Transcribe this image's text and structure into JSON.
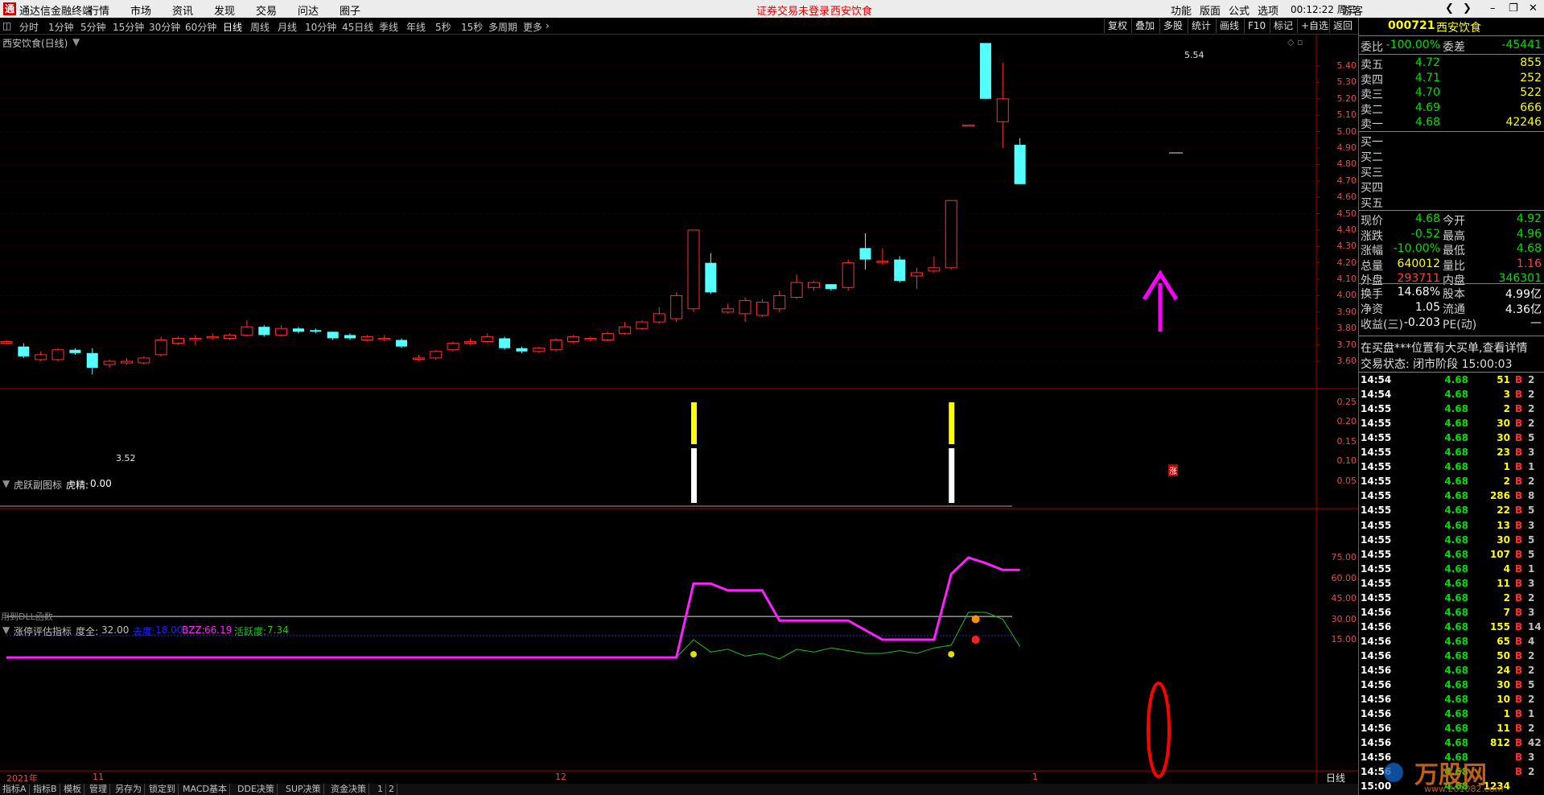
{
  "titlebar": {
    "app_title": "通达信金融终端",
    "menus": [
      "行情",
      "市场",
      "资讯",
      "发现",
      "交易",
      "问达",
      "圈子"
    ],
    "warning": "证券交易未登录",
    "stock_name": "西安饮食",
    "right_menus": [
      "功能",
      "版面",
      "公式",
      "选项"
    ],
    "clock": "00:12:22 周三",
    "user": "游客"
  },
  "periods": [
    "分时",
    "1分钟",
    "5分钟",
    "15分钟",
    "30分钟",
    "60分钟",
    "日线",
    "周线",
    "月线",
    "10分钟",
    "45日线",
    "季线",
    "年线",
    "5秒",
    "15秒",
    "多周期",
    "更多"
  ],
  "active_period": "日线",
  "toolbar": [
    "复权",
    "叠加",
    "多股",
    "统计",
    "画线",
    "F10",
    "标记",
    "+自选",
    "返回"
  ],
  "main_chart": {
    "title": "西安饮食(日线)",
    "high_label": "5.54",
    "low_label": "3.52",
    "badge": "涨",
    "y_ticks": [
      "5.40",
      "5.30",
      "5.20",
      "5.10",
      "5.00",
      "4.90",
      "4.80",
      "4.70",
      "4.60",
      "4.50",
      "4.40",
      "4.30",
      "4.20",
      "4.10",
      "4.00",
      "3.90",
      "3.80",
      "3.70",
      "3.60"
    ]
  },
  "indicator1": {
    "title": "虎跃副图标",
    "param_label": "虎精:",
    "param_value": "0.00",
    "footer": "用到DLL函数",
    "y_ticks": [
      "0.25",
      "0.20",
      "0.15",
      "0.10",
      "0.05"
    ]
  },
  "indicator2": {
    "title": "涨停评估指标",
    "items": [
      {
        "label": "度全:",
        "value": "32.00",
        "color": "#c0c0c0"
      },
      {
        "label": "去度:",
        "value": "18.00",
        "color": "#2020ff"
      },
      {
        "label": "BZZ:",
        "value": "66.19",
        "color": "#ff20ff"
      },
      {
        "label": "活跃度:",
        "value": "7.34",
        "color": "#20c020"
      }
    ],
    "y_ticks": [
      "75.00",
      "60.00",
      "45.00",
      "30.00",
      "15.00"
    ]
  },
  "x_axis": {
    "labels": [
      "2021年",
      "11",
      "12",
      "1"
    ],
    "right_label": "日线"
  },
  "bottom_tabs": [
    "指标A",
    "指标B",
    "模板",
    "管理",
    "另存为",
    "锁定到",
    "MACD基本",
    "DDE决策",
    "SUP决策",
    "资金决策",
    "1",
    "2"
  ],
  "info": {
    "code": "000721",
    "name": "西安饮食",
    "weibi_label": "委比",
    "weibi": "-100.00%",
    "weicha_label": "委差",
    "weicha": "-45441",
    "asks": [
      {
        "label": "卖五",
        "price": "4.72",
        "vol": "855"
      },
      {
        "label": "卖四",
        "price": "4.71",
        "vol": "252"
      },
      {
        "label": "卖三",
        "price": "4.70",
        "vol": "522"
      },
      {
        "label": "卖二",
        "price": "4.69",
        "vol": "666"
      },
      {
        "label": "卖一",
        "price": "4.68",
        "vol": "42246"
      }
    ],
    "bids": [
      "买一",
      "买二",
      "买三",
      "买四",
      "买五"
    ],
    "stats": [
      {
        "l1": "现价",
        "v1": "4.68",
        "c1": "green",
        "l2": "今开",
        "v2": "4.92",
        "c2": "green"
      },
      {
        "l1": "涨跌",
        "v1": "-0.52",
        "c1": "green",
        "l2": "最高",
        "v2": "4.96",
        "c2": "green"
      },
      {
        "l1": "涨幅",
        "v1": "-10.00%",
        "c1": "green",
        "l2": "最低",
        "v2": "4.68",
        "c2": "green"
      },
      {
        "l1": "总量",
        "v1": "640012",
        "c1": "yellow",
        "l2": "量比",
        "v2": "1.16",
        "c2": "red"
      },
      {
        "l1": "外盘",
        "v1": "293711",
        "c1": "red",
        "l2": "内盘",
        "v2": "346301",
        "c2": "green"
      }
    ],
    "fund": [
      {
        "l1": "换手",
        "v1": "14.68%",
        "l2": "股本",
        "v2": "4.99亿"
      },
      {
        "l1": "净资",
        "v1": "1.05",
        "l2": "流通",
        "v2": "4.36亿"
      },
      {
        "l1": "收益(三)",
        "v1": "-0.203",
        "l2": "PE(动)",
        "v2": "—"
      }
    ],
    "notice": "在买盘***位置有大买单,查看详情",
    "status": "交易状态: 闭市阶段 15:00:03",
    "ticks": [
      {
        "t": "14:54",
        "p": "4.68",
        "v": "51",
        "b": "B",
        "e": "2"
      },
      {
        "t": "14:54",
        "p": "4.68",
        "v": "3",
        "b": "B",
        "e": "2"
      },
      {
        "t": "14:55",
        "p": "4.68",
        "v": "2",
        "b": "B",
        "e": "2"
      },
      {
        "t": "14:55",
        "p": "4.68",
        "v": "30",
        "b": "B",
        "e": "2"
      },
      {
        "t": "14:55",
        "p": "4.68",
        "v": "30",
        "b": "B",
        "e": "5"
      },
      {
        "t": "14:55",
        "p": "4.68",
        "v": "23",
        "b": "B",
        "e": "3"
      },
      {
        "t": "14:55",
        "p": "4.68",
        "v": "1",
        "b": "B",
        "e": "1"
      },
      {
        "t": "14:55",
        "p": "4.68",
        "v": "2",
        "b": "B",
        "e": "2"
      },
      {
        "t": "14:55",
        "p": "4.68",
        "v": "286",
        "b": "B",
        "e": "8"
      },
      {
        "t": "14:55",
        "p": "4.68",
        "v": "22",
        "b": "B",
        "e": "5"
      },
      {
        "t": "14:55",
        "p": "4.68",
        "v": "13",
        "b": "B",
        "e": "3"
      },
      {
        "t": "14:55",
        "p": "4.68",
        "v": "30",
        "b": "B",
        "e": "5"
      },
      {
        "t": "14:55",
        "p": "4.68",
        "v": "107",
        "b": "B",
        "e": "5"
      },
      {
        "t": "14:55",
        "p": "4.68",
        "v": "4",
        "b": "B",
        "e": "1"
      },
      {
        "t": "14:55",
        "p": "4.68",
        "v": "11",
        "b": "B",
        "e": "3"
      },
      {
        "t": "14:55",
        "p": "4.68",
        "v": "2",
        "b": "B",
        "e": "2"
      },
      {
        "t": "14:56",
        "p": "4.68",
        "v": "7",
        "b": "B",
        "e": "3"
      },
      {
        "t": "14:56",
        "p": "4.68",
        "v": "155",
        "b": "B",
        "e": "14"
      },
      {
        "t": "14:56",
        "p": "4.68",
        "v": "65",
        "b": "B",
        "e": "4"
      },
      {
        "t": "14:56",
        "p": "4.68",
        "v": "50",
        "b": "B",
        "e": "2"
      },
      {
        "t": "14:56",
        "p": "4.68",
        "v": "24",
        "b": "B",
        "e": "2"
      },
      {
        "t": "14:56",
        "p": "4.68",
        "v": "30",
        "b": "B",
        "e": "5"
      },
      {
        "t": "14:56",
        "p": "4.68",
        "v": "10",
        "b": "B",
        "e": "2"
      },
      {
        "t": "14:56",
        "p": "4.68",
        "v": "1",
        "b": "B",
        "e": "1"
      },
      {
        "t": "14:56",
        "p": "4.68",
        "v": "11",
        "b": "B",
        "e": "2"
      },
      {
        "t": "14:56",
        "p": "4.68",
        "v": "812",
        "b": "B",
        "e": "42"
      },
      {
        "t": "14:56",
        "p": "4.68",
        "v": "",
        "b": "B",
        "e": "3"
      },
      {
        "t": "14:56",
        "p": "4.68",
        "v": "",
        "b": "B",
        "e": "2"
      },
      {
        "t": "15:00",
        "p": "4.68",
        "v": "1234",
        "b": "",
        "e": ""
      }
    ]
  },
  "watermark": {
    "text": "万股网",
    "url": "www.201082.com"
  },
  "chart_data": {
    "type": "candlestick",
    "title": "西安饮食(日线)",
    "ylim": [
      3.52,
      5.54
    ],
    "candles": [
      {
        "o": 3.71,
        "c": 3.72,
        "h": 3.73,
        "l": 3.7
      },
      {
        "o": 3.69,
        "c": 3.63,
        "h": 3.71,
        "l": 3.62
      },
      {
        "o": 3.61,
        "c": 3.64,
        "h": 3.66,
        "l": 3.6
      },
      {
        "o": 3.61,
        "c": 3.67,
        "h": 3.68,
        "l": 3.6
      },
      {
        "o": 3.67,
        "c": 3.65,
        "h": 3.68,
        "l": 3.64
      },
      {
        "o": 3.65,
        "c": 3.56,
        "h": 3.68,
        "l": 3.52
      },
      {
        "o": 3.58,
        "c": 3.6,
        "h": 3.61,
        "l": 3.56
      },
      {
        "o": 3.59,
        "c": 3.6,
        "h": 3.62,
        "l": 3.58
      },
      {
        "o": 3.59,
        "c": 3.62,
        "h": 3.63,
        "l": 3.58
      },
      {
        "o": 3.64,
        "c": 3.73,
        "h": 3.75,
        "l": 3.63
      },
      {
        "o": 3.71,
        "c": 3.74,
        "h": 3.75,
        "l": 3.7
      },
      {
        "o": 3.74,
        "c": 3.74,
        "h": 3.76,
        "l": 3.7
      },
      {
        "o": 3.75,
        "c": 3.75,
        "h": 3.77,
        "l": 3.73
      },
      {
        "o": 3.74,
        "c": 3.76,
        "h": 3.77,
        "l": 3.73
      },
      {
        "o": 3.76,
        "c": 3.81,
        "h": 3.85,
        "l": 3.75
      },
      {
        "o": 3.81,
        "c": 3.76,
        "h": 3.82,
        "l": 3.75
      },
      {
        "o": 3.76,
        "c": 3.8,
        "h": 3.82,
        "l": 3.75
      },
      {
        "o": 3.8,
        "c": 3.78,
        "h": 3.81,
        "l": 3.77
      },
      {
        "o": 3.79,
        "c": 3.78,
        "h": 3.8,
        "l": 3.77
      },
      {
        "o": 3.78,
        "c": 3.74,
        "h": 3.78,
        "l": 3.73
      },
      {
        "o": 3.76,
        "c": 3.74,
        "h": 3.77,
        "l": 3.73
      },
      {
        "o": 3.73,
        "c": 3.75,
        "h": 3.76,
        "l": 3.72
      },
      {
        "o": 3.74,
        "c": 3.74,
        "h": 3.76,
        "l": 3.72
      },
      {
        "o": 3.73,
        "c": 3.69,
        "h": 3.74,
        "l": 3.68
      },
      {
        "o": 3.62,
        "c": 3.62,
        "h": 3.64,
        "l": 3.6
      },
      {
        "o": 3.62,
        "c": 3.66,
        "h": 3.67,
        "l": 3.61
      },
      {
        "o": 3.67,
        "c": 3.71,
        "h": 3.72,
        "l": 3.66
      },
      {
        "o": 3.71,
        "c": 3.72,
        "h": 3.74,
        "l": 3.7
      },
      {
        "o": 3.72,
        "c": 3.75,
        "h": 3.77,
        "l": 3.71
      },
      {
        "o": 3.74,
        "c": 3.68,
        "h": 3.75,
        "l": 3.67
      },
      {
        "o": 3.68,
        "c": 3.66,
        "h": 3.69,
        "l": 3.65
      },
      {
        "o": 3.66,
        "c": 3.68,
        "h": 3.69,
        "l": 3.65
      },
      {
        "o": 3.67,
        "c": 3.73,
        "h": 3.74,
        "l": 3.66
      },
      {
        "o": 3.72,
        "c": 3.75,
        "h": 3.76,
        "l": 3.71
      },
      {
        "o": 3.74,
        "c": 3.74,
        "h": 3.75,
        "l": 3.72
      },
      {
        "o": 3.73,
        "c": 3.77,
        "h": 3.78,
        "l": 3.72
      },
      {
        "o": 3.77,
        "c": 3.81,
        "h": 3.84,
        "l": 3.76
      },
      {
        "o": 3.8,
        "c": 3.84,
        "h": 3.85,
        "l": 3.79
      },
      {
        "o": 3.84,
        "c": 3.89,
        "h": 3.93,
        "l": 3.83
      },
      {
        "o": 3.86,
        "c": 4.0,
        "h": 4.02,
        "l": 3.84
      },
      {
        "o": 3.92,
        "c": 4.4,
        "h": 4.4,
        "l": 3.9
      },
      {
        "o": 4.2,
        "c": 4.02,
        "h": 4.26,
        "l": 4.01
      },
      {
        "o": 3.9,
        "c": 3.92,
        "h": 3.95,
        "l": 3.89
      },
      {
        "o": 3.89,
        "c": 3.97,
        "h": 3.99,
        "l": 3.84
      },
      {
        "o": 3.88,
        "c": 3.96,
        "h": 3.98,
        "l": 3.87
      },
      {
        "o": 3.92,
        "c": 4.0,
        "h": 4.03,
        "l": 3.9
      },
      {
        "o": 3.99,
        "c": 4.08,
        "h": 4.13,
        "l": 3.98
      },
      {
        "o": 4.05,
        "c": 4.08,
        "h": 4.09,
        "l": 4.03
      },
      {
        "o": 4.07,
        "c": 4.04,
        "h": 4.07,
        "l": 4.03
      },
      {
        "o": 4.05,
        "c": 4.2,
        "h": 4.22,
        "l": 4.03
      },
      {
        "o": 4.29,
        "c": 4.22,
        "h": 4.38,
        "l": 4.16
      },
      {
        "o": 4.21,
        "c": 4.21,
        "h": 4.29,
        "l": 4.19
      },
      {
        "o": 4.22,
        "c": 4.09,
        "h": 4.24,
        "l": 4.08
      },
      {
        "o": 4.12,
        "c": 4.14,
        "h": 4.17,
        "l": 4.04
      },
      {
        "o": 4.15,
        "c": 4.17,
        "h": 4.24,
        "l": 4.14
      },
      {
        "o": 4.17,
        "c": 4.58,
        "h": 4.58,
        "l": 4.16
      },
      {
        "o": 5.04,
        "c": 5.04,
        "h": 5.04,
        "l": 5.04
      },
      {
        "o": 5.54,
        "c": 5.2,
        "h": 5.54,
        "l": 5.2
      },
      {
        "o": 5.06,
        "c": 5.2,
        "h": 5.42,
        "l": 4.9
      },
      {
        "o": 4.92,
        "c": 4.68,
        "h": 4.96,
        "l": 4.68
      }
    ],
    "indicator1_bars": [
      {
        "index": 40,
        "value": 0.25
      },
      {
        "index": 55,
        "value": 0.25
      }
    ],
    "indicator2": {
      "ylim": [
        0,
        80
      ],
      "ref_lines": [
        32.0,
        18.0
      ],
      "bzz": [
        {
          "i": 0,
          "v": 2
        },
        {
          "i": 39,
          "v": 2
        },
        {
          "i": 40,
          "v": 56
        },
        {
          "i": 41,
          "v": 56
        },
        {
          "i": 42,
          "v": 51
        },
        {
          "i": 44,
          "v": 51
        },
        {
          "i": 45,
          "v": 29
        },
        {
          "i": 49,
          "v": 29
        },
        {
          "i": 51,
          "v": 15
        },
        {
          "i": 54,
          "v": 15
        },
        {
          "i": 55,
          "v": 63
        },
        {
          "i": 56,
          "v": 75
        },
        {
          "i": 57,
          "v": 71
        },
        {
          "i": 58,
          "v": 66
        },
        {
          "i": 59,
          "v": 66
        }
      ],
      "activity": [
        {
          "i": 0,
          "v": 2
        },
        {
          "i": 39,
          "v": 2
        },
        {
          "i": 40,
          "v": 15
        },
        {
          "i": 41,
          "v": 6
        },
        {
          "i": 42,
          "v": 8
        },
        {
          "i": 43,
          "v": 3
        },
        {
          "i": 44,
          "v": 5
        },
        {
          "i": 45,
          "v": 1
        },
        {
          "i": 46,
          "v": 8
        },
        {
          "i": 47,
          "v": 6
        },
        {
          "i": 48,
          "v": 9
        },
        {
          "i": 50,
          "v": 5
        },
        {
          "i": 51,
          "v": 5
        },
        {
          "i": 52,
          "v": 7
        },
        {
          "i": 53,
          "v": 5
        },
        {
          "i": 54,
          "v": 9
        },
        {
          "i": 55,
          "v": 11
        },
        {
          "i": 56,
          "v": 35
        },
        {
          "i": 57,
          "v": 35
        },
        {
          "i": 58,
          "v": 30
        },
        {
          "i": 59,
          "v": 10
        }
      ]
    }
  }
}
